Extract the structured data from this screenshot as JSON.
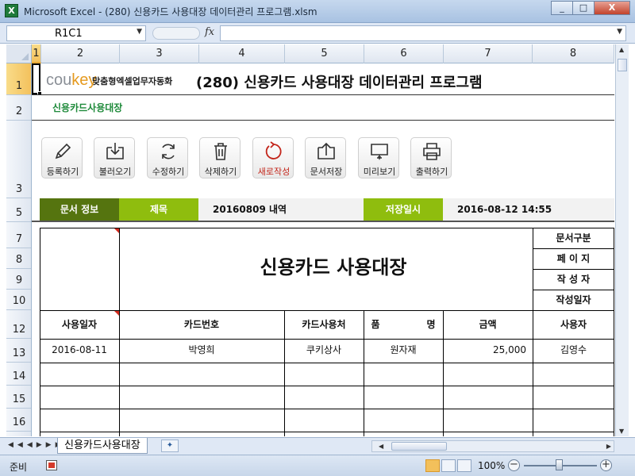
{
  "window": {
    "title": "Microsoft Excel - (280) 신용카드 사용대장 데이터관리 프로그램.xlsm",
    "min": "_",
    "max": "□",
    "close": "X",
    "app_icon": "X"
  },
  "formula_bar": {
    "name_box": "R1C1",
    "fx": "fx",
    "formula": ""
  },
  "columns": [
    "1",
    "2",
    "3",
    "4",
    "5",
    "6",
    "7",
    "8"
  ],
  "rows": [
    "1",
    "2",
    "3",
    "5",
    "7",
    "8",
    "9",
    "10",
    "12",
    "13",
    "14",
    "15",
    "16"
  ],
  "header": {
    "logo_main": "cou",
    "logo_accent": "key",
    "tagline": "맞춤형엑셀업무자동화",
    "title": "(280) 신용카드 사용대장 데이터관리 프로그램",
    "sub_title": "신용카드사용대장"
  },
  "toolbar": [
    {
      "label": "등록하기",
      "icon": "pencil-icon"
    },
    {
      "label": "불러오기",
      "icon": "load-icon"
    },
    {
      "label": "수정하기",
      "icon": "refresh-icon"
    },
    {
      "label": "삭제하기",
      "icon": "trash-icon"
    },
    {
      "label": "새로작성",
      "icon": "new-icon"
    },
    {
      "label": "문서저장",
      "icon": "save-icon"
    },
    {
      "label": "미리보기",
      "icon": "preview-icon"
    },
    {
      "label": "출력하기",
      "icon": "print-icon"
    }
  ],
  "info_row": {
    "doc_info_label": "문서 정보",
    "title_label": "제목",
    "title_value": "20160809 내역",
    "saved_label": "저장일시",
    "saved_value": "2016-08-12 14:55"
  },
  "document": {
    "title": "신용카드 사용대장",
    "side_labels": [
      "문서구분",
      "페 이 지",
      "작 성 자",
      "작성일자"
    ],
    "columns": [
      "사용일자",
      "카드번호",
      "카드사용처",
      "품",
      "명",
      "금액",
      "사용자"
    ],
    "rows": [
      {
        "date": "2016-08-11",
        "card": "박영희",
        "store": "쿠키상사",
        "item": "원자재",
        "amount": "25,000",
        "user": "김영수"
      }
    ]
  },
  "sheet_tabs": {
    "active": "신용카드사용대장"
  },
  "status": {
    "ready": "준비",
    "zoom": "100%",
    "zoom_minus": "−",
    "zoom_plus": "+"
  },
  "colors": {
    "accent_dark_green": "#55740f",
    "accent_light_green": "#8fbd0e",
    "subtitle_green": "#1e8a3a",
    "red": "#c3261b"
  }
}
